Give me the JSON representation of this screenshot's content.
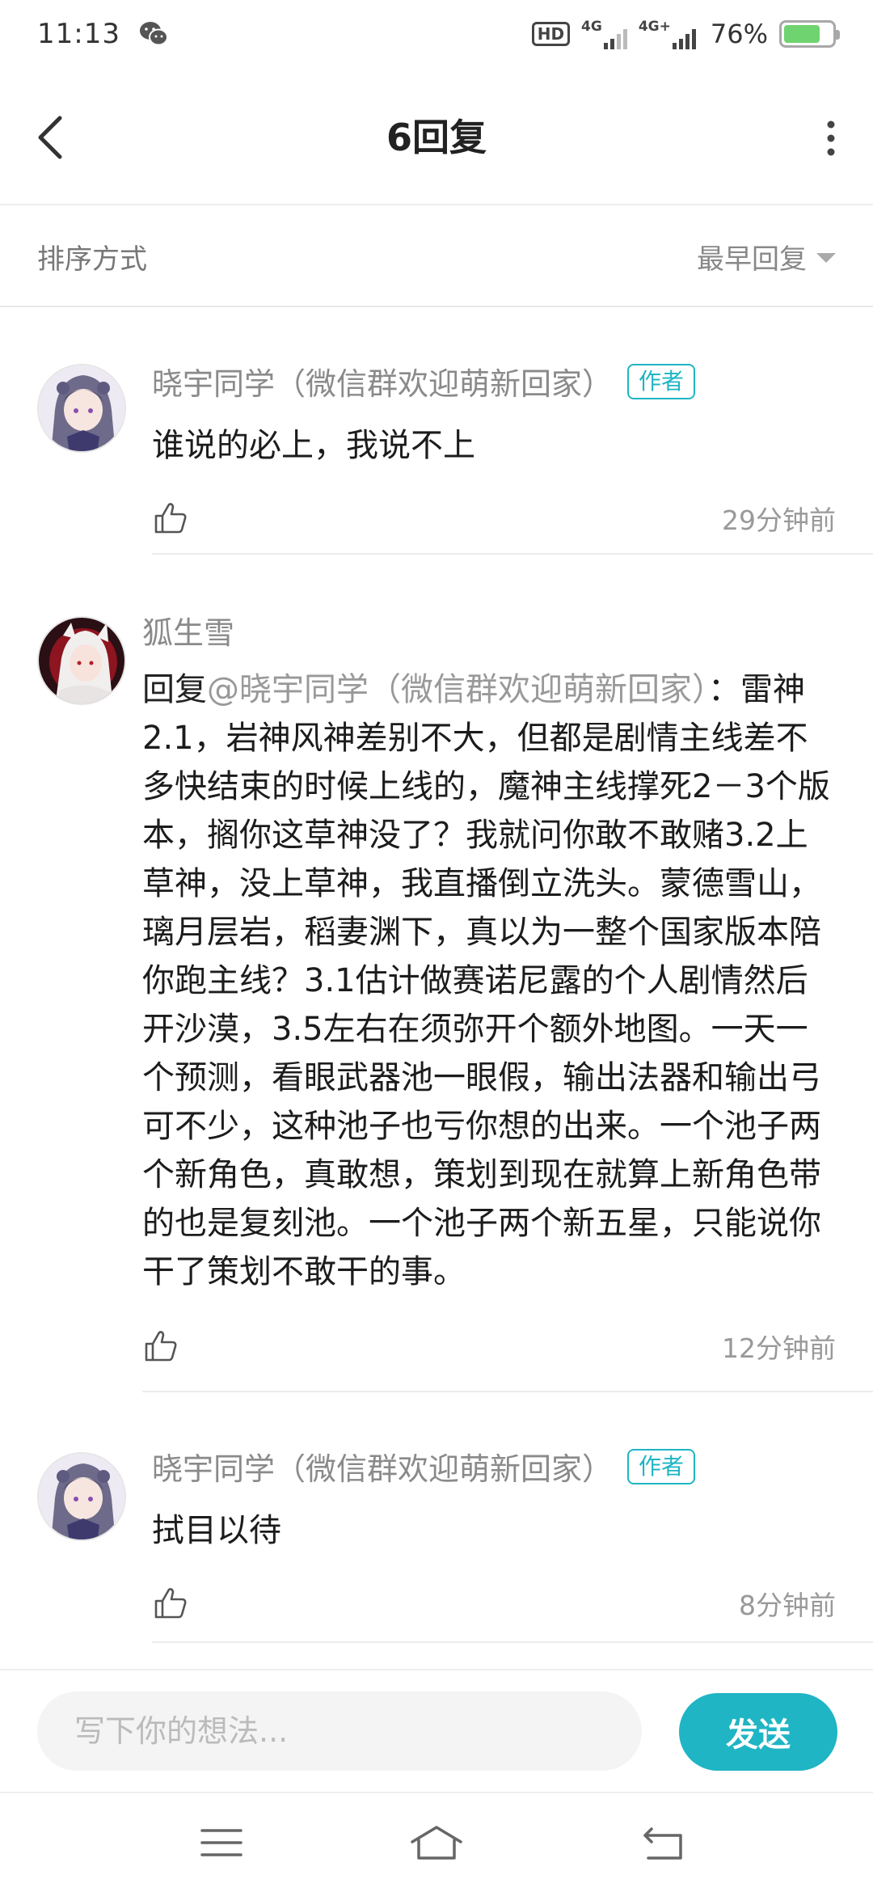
{
  "status_bar": {
    "time": "11:13",
    "hd_label": "HD",
    "net1_label": "4G",
    "net2_label": "4G+",
    "battery_percent": "76%",
    "battery_level": 0.76
  },
  "header": {
    "title": "6回复",
    "back_icon": "chevron-left-icon",
    "more_icon": "more-vertical-icon"
  },
  "sort": {
    "label": "排序方式",
    "value": "最早回复"
  },
  "comments": [
    {
      "username": "晓宇同学（微信群欢迎萌新回家）",
      "tag": "作者",
      "text": "谁说的必上，我说不上",
      "time": "29分钟前"
    },
    {
      "username": "狐生雪",
      "reply_prefix": "回复",
      "reply_target": "@晓宇同学（微信群欢迎萌新回家）",
      "text": "：雷神2.1，岩神风神差别不大，但都是剧情主线差不多快结束的时候上线的，魔神主线撑死2－3个版本，搁你这草神没了？我就问你敢不敢赌3.2上草神，没上草神，我直播倒立洗头。蒙德雪山，璃月层岩，稻妻渊下，真以为一整个国家版本陪你跑主线？3.1估计做赛诺尼露的个人剧情然后开沙漠，3.5左右在须弥开个额外地图。一天一个预测，看眼武器池一眼假，输出法器和输出弓可不少，这种池子也亏你想的出来。一个池子两个新角色，真敢想，策划到现在就算上新角色带的也是复刻池。一个池子两个新五星，只能说你干了策划不敢干的事。",
      "time": "12分钟前"
    },
    {
      "username": "晓宇同学（微信群欢迎萌新回家）",
      "tag": "作者",
      "text": "拭目以待",
      "time": "8分钟前"
    }
  ],
  "input_bar": {
    "placeholder": "写下你的想法...",
    "send_label": "发送"
  },
  "colors": {
    "accent": "#1fb5c4",
    "text_primary": "#1c1c1c",
    "text_secondary": "#8a8a8a"
  }
}
